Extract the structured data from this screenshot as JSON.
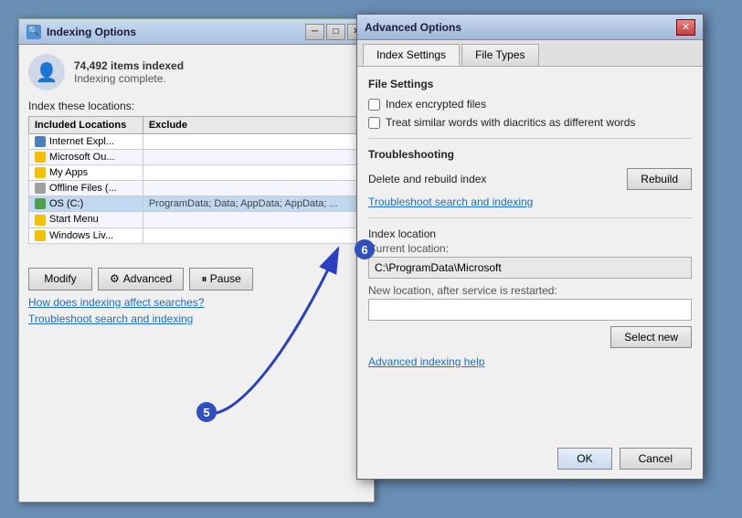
{
  "indexing_window": {
    "title": "Indexing Options",
    "items_indexed": "74,492 items indexed",
    "status": "Indexing complete.",
    "section_label": "Index these locations:",
    "table": {
      "headers": [
        "Included Locations",
        "Exclude"
      ],
      "rows": [
        {
          "location": "Internet Expl...",
          "exclude": "",
          "icon": "blue"
        },
        {
          "location": "Microsoft Ou...",
          "exclude": "",
          "icon": "yellow"
        },
        {
          "location": "My Apps",
          "exclude": "",
          "icon": "folder"
        },
        {
          "location": "Offline Files (...",
          "exclude": "",
          "icon": "gray"
        },
        {
          "location": "OS (C:)",
          "exclude": "ProgramData; Data; AppData; AppData; ...",
          "icon": "green"
        },
        {
          "location": "Start Menu",
          "exclude": "",
          "icon": "folder"
        },
        {
          "location": "Windows Liv...",
          "exclude": "",
          "icon": "folder"
        }
      ]
    },
    "buttons": {
      "modify": "Modify",
      "advanced": "Advanced",
      "pause": "Pause"
    },
    "links": {
      "indexing_affect": "How does indexing affect searches?",
      "troubleshoot": "Troubleshoot search and indexing"
    }
  },
  "advanced_dialog": {
    "title": "Advanced Options",
    "tabs": {
      "index_settings": "Index Settings",
      "file_types": "File Types"
    },
    "file_settings": {
      "header": "File Settings",
      "checkbox1": "Index encrypted files",
      "checkbox2": "Treat similar words with diacritics as different words"
    },
    "troubleshooting": {
      "header": "Troubleshooting",
      "rebuild_label": "Delete and rebuild index",
      "rebuild_btn": "Rebuild",
      "troubleshoot_link": "Troubleshoot search and indexing"
    },
    "index_location": {
      "header": "Index location",
      "current_label": "Current location:",
      "current_value": "C:\\ProgramData\\Microsoft",
      "new_label": "New location, after service is restarted:",
      "new_value": "",
      "select_new_btn": "Select new"
    },
    "advanced_link": "Advanced indexing help",
    "footer": {
      "ok": "OK",
      "cancel": "Cancel"
    }
  },
  "annotations": {
    "circle5": "5",
    "circle6": "6"
  }
}
